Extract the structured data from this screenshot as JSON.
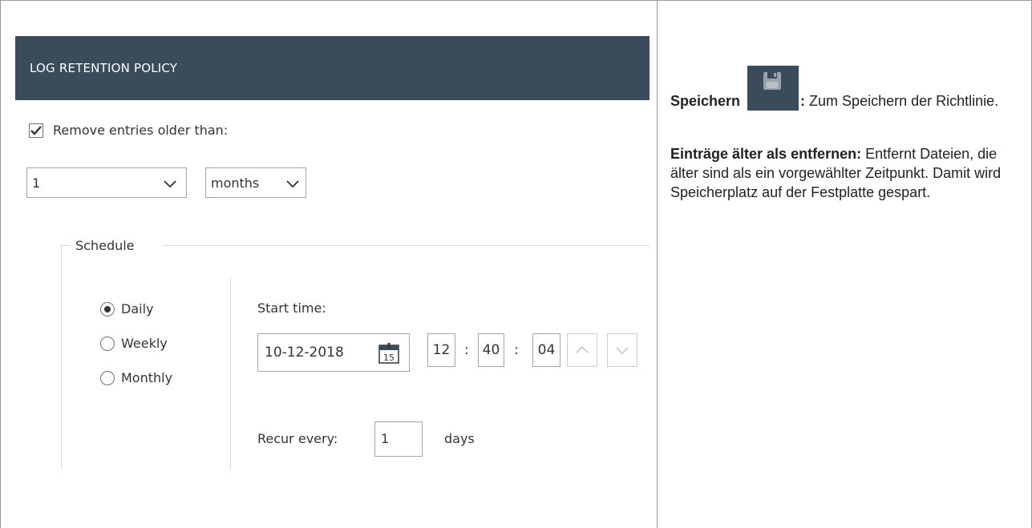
{
  "panel": {
    "title": "LOG RETENTION POLICY",
    "remove_entries_label": "Remove entries older than:",
    "remove_entries_checked": true,
    "age_value": "1",
    "age_unit": "months",
    "schedule": {
      "group_label": "Schedule",
      "frequency_options": [
        {
          "label": "Daily",
          "selected": true
        },
        {
          "label": "Weekly",
          "selected": false
        },
        {
          "label": "Monthly",
          "selected": false
        }
      ],
      "start_time_label": "Start time:",
      "start_date": "10-12-2018",
      "calendar_day": "15",
      "hour": "12",
      "minute": "40",
      "second": "04",
      "time_separator": ":",
      "recur_label": "Recur every:",
      "recur_value": "1",
      "recur_unit": "days"
    }
  },
  "description": {
    "save_term": "Speichern",
    "save_colon": ":",
    "save_text": " Zum Speichern der Richtlinie.",
    "remove_term": "Einträge älter als entfernen:",
    "remove_text": " Entfernt Dateien, die älter sind als ein vorgewählter Zeitpunkt. Damit wird Speicherplatz auf der Festplatte gespart."
  },
  "icons": {
    "save": "floppy-disk-icon",
    "calendar": "calendar-icon",
    "checkmark": "checkmark-icon",
    "chevron": "chevron-down-icon",
    "spin_up": "chevron-up-icon",
    "spin_down": "chevron-down-icon"
  },
  "colors": {
    "header_bg": "#3a4b5c",
    "header_text": "#ffffff",
    "border": "#a6a6a6"
  }
}
